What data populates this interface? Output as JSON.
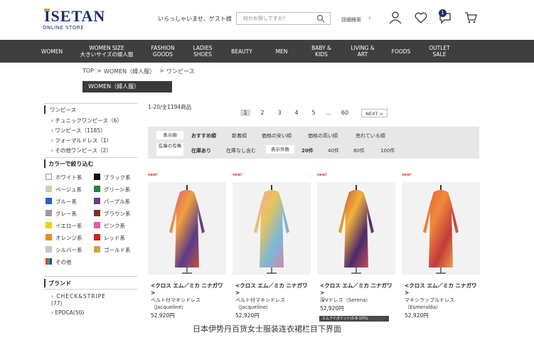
{
  "header": {
    "logo_main": "ISETAN",
    "logo_sub": "ONLINE STORE",
    "welcome": "いらっしゃいませ、ゲスト様",
    "search_placeholder": "何かお探しですか？",
    "advanced_search": "詳細検索",
    "cart_badge": "1"
  },
  "nav": [
    {
      "label": "WOMEN"
    },
    {
      "label": "WOMEN SIZE\n大きいサイズの婦人服"
    },
    {
      "label": "FASHION\nGOODS"
    },
    {
      "label": "LADIES\nSHOES"
    },
    {
      "label": "BEAUTY"
    },
    {
      "label": "MEN"
    },
    {
      "label": "BABY &\nKIDS"
    },
    {
      "label": "LIVING &\nART"
    },
    {
      "label": "FOODS"
    },
    {
      "label": "OUTLET\nSALE"
    }
  ],
  "breadcrumb": [
    "TOP",
    "WOMEN（婦人服）",
    "ワンピース"
  ],
  "breadcrumb_sep": ">",
  "category_bar": "WOMEN（婦人服）",
  "sidebar": {
    "category_title": "ワンピース",
    "subcategories": [
      "チュニックワンピース（6）",
      "ワンピース（1185）",
      "フォーマルドレス（1）",
      "その他ワンピース（2）"
    ],
    "color_title": "カラーで絞り込む",
    "colors": [
      {
        "label": "ホワイト系",
        "hex": "#ffffff"
      },
      {
        "label": "ブラック系",
        "hex": "#111111"
      },
      {
        "label": "ベージュ系",
        "hex": "#d9c9a3"
      },
      {
        "label": "グリーン系",
        "hex": "#2f7d3a"
      },
      {
        "label": "ブルー系",
        "hex": "#1f5fd1"
      },
      {
        "label": "パープル系",
        "hex": "#6a3a8c"
      },
      {
        "label": "グレー系",
        "hex": "#999999"
      },
      {
        "label": "ブラウン系",
        "hex": "#6b3a1e"
      },
      {
        "label": "イエロー系",
        "hex": "#f2d000"
      },
      {
        "label": "ピンク系",
        "hex": "#e85c9a"
      },
      {
        "label": "オレンジ系",
        "hex": "#f08a1c"
      },
      {
        "label": "レッド系",
        "hex": "#d41e1e"
      },
      {
        "label": "シルバー系",
        "hex": "#c7c7c7"
      },
      {
        "label": "ゴールド系",
        "hex": "#c9a640"
      },
      {
        "label": "その他",
        "hex": "multi"
      }
    ],
    "brand_title": "ブランド",
    "brands": [
      "CHECK&STRIPE",
      "(77)",
      "EPOCA(50)"
    ]
  },
  "results": {
    "count": "1-20/全1194商品",
    "pages": [
      "1",
      "2",
      "3",
      "4",
      "5",
      "…",
      "60"
    ],
    "next": "NEXT >"
  },
  "filters": {
    "sort_label": "表示順",
    "sort_options": [
      "おすすめ順",
      "新着順",
      "価格の安い順",
      "価格の高い順",
      "売れている順"
    ],
    "stock_label": "在庫の有無",
    "stock_options": [
      "在庫あり",
      "在庫なし含む"
    ],
    "per_page_label": "表示件数",
    "per_page_options": [
      "20件",
      "40件",
      "80件",
      "100件"
    ]
  },
  "new_tag": "new!",
  "products": [
    {
      "brand": "<クロス エム／ミカ ニナガワ>",
      "name": "ベルト付マキシドレス（Jacqueline）",
      "price": "52,920円"
    },
    {
      "brand": "<クロス エム／ミカ ニナガワ>",
      "name": "ベルト付マキシドレス（Jacqueline）",
      "price": "52,920円"
    },
    {
      "brand": "<クロス エム／ミカ ニナガワ>",
      "name": "深Vドレス（Serena）",
      "price": "52,920円"
    },
    {
      "brand": "<クロス エム／ミカ ニナガワ>",
      "name": "マキシラップルドレス（Esmeralda）",
      "price": "52,920円"
    }
  ],
  "product_badge": "エムアイポイント(5-8-10%)",
  "caption": "日本伊势丹百货女士服装连衣裙栏目下界面"
}
